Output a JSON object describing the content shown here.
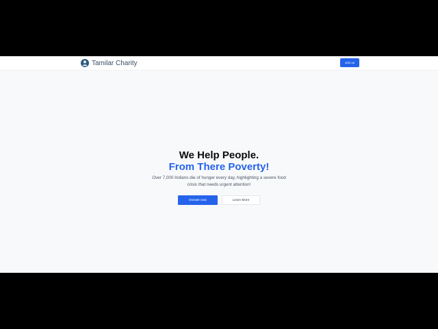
{
  "navbar": {
    "brand_name": "Tamilar Charity",
    "join_label": "Join us"
  },
  "hero": {
    "title_line1": "We Help People.",
    "title_line2": "From There Poverty!",
    "subtitle": "Over 7,000 Indians die of hunger every day, highlighting a severe food crisis that needs urgent attention!",
    "donate_label": "Donate now",
    "learn_label": "Learn More"
  },
  "colors": {
    "accent": "#2563eb",
    "page_background": "#f8f9fb",
    "letterbox": "#000000"
  },
  "icons": {
    "logo": "charity-logo-icon"
  }
}
